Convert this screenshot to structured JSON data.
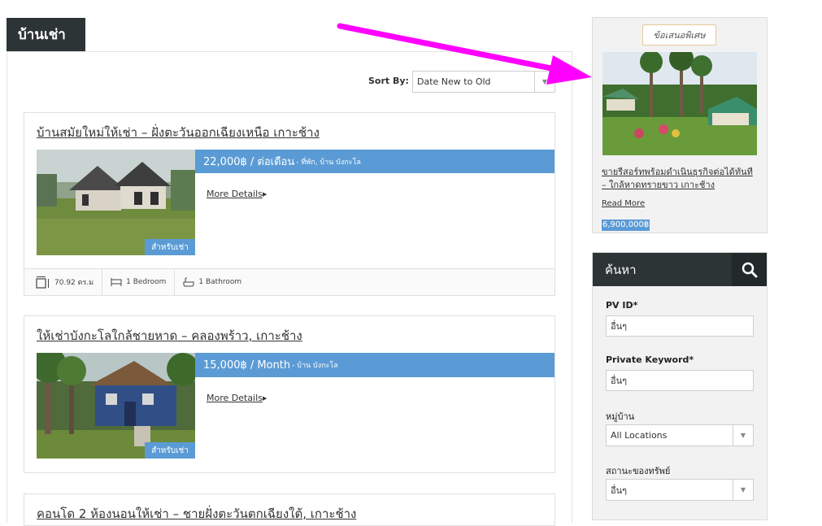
{
  "page_tab": "บ้านเช่า",
  "sort": {
    "label": "Sort By:",
    "value": "Date New to Old"
  },
  "listings": [
    {
      "title": "บ้านสมัยใหม่ให้เช่า – ฝั่งตะวันออกเฉียงเหนือ เกาะช้าง",
      "price": "22,000฿ / ต่อเดือน",
      "location": "- ที่พัก, บ้าน บังกะโล",
      "more": "More Details",
      "badge": "สำหรับเช่า",
      "area": "70.92 ตร.ม",
      "bedrooms": "1 Bedroom",
      "bathrooms": "1 Bathroom"
    },
    {
      "title": "ให้เช่าบังกะโลใกล้ชายหาด – คลองพร้าว, เกาะช้าง",
      "price": "15,000฿ / Month",
      "location": "- บ้าน บังกะโล",
      "more": "More Details",
      "badge": "สำหรับเช่า"
    },
    {
      "title": "คอนโด 2 ห้องนอนให้เช่า – ชายฝั่งตะวันตกเฉียงใต้, เกาะช้าง"
    }
  ],
  "offer": {
    "tag": "ข้อเสนอพิเศษ",
    "title": "ขายรีสอร์ทพร้อมดำเนินธุรกิจต่อได้ทันที – ใกล้หาดทรายขาว เกาะช้าง",
    "read_more": "Read More",
    "price": "6,900,000฿"
  },
  "search": {
    "title": "ค้นหา",
    "fields": [
      {
        "label": "PV ID*",
        "value": "อื่นๆ"
      },
      {
        "label": "Private Keyword*",
        "value": "อื่นๆ"
      },
      {
        "label": "หมู่บ้าน",
        "value": "All Locations"
      },
      {
        "label": "สถานะของทรัพย์",
        "value": "อื่นๆ"
      }
    ]
  },
  "colors": {
    "accent": "#5b9bd5",
    "header_dark": "#2d3436",
    "pointer": "#ff00ff"
  },
  "icons": [
    "area-icon",
    "bed-icon",
    "bath-icon",
    "search-icon",
    "caret-right-icon",
    "chevron-down-icon"
  ]
}
